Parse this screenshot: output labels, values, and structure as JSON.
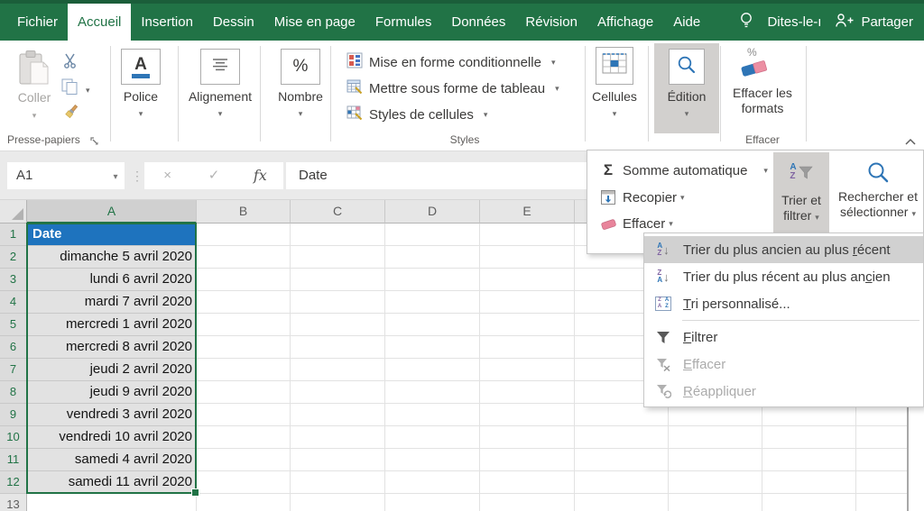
{
  "titlebar": {
    "tabs": [
      "Fichier",
      "Accueil",
      "Insertion",
      "Dessin",
      "Mise en page",
      "Formules",
      "Données",
      "Révision",
      "Affichage",
      "Aide"
    ],
    "active_tab": "Accueil",
    "tell_me": "Dites-le-ı",
    "share": "Partager"
  },
  "ribbon": {
    "clipboard": {
      "paste": "Coller",
      "group": "Presse-papiers"
    },
    "font": {
      "glyph": "A",
      "label": "Police"
    },
    "alignment": {
      "label": "Alignement"
    },
    "number": {
      "glyph": "%",
      "label": "Nombre"
    },
    "styles": {
      "conditional": "Mise en forme conditionnelle",
      "format_table": "Mettre sous forme de tableau",
      "cell_styles": "Styles de cellules",
      "group": "Styles"
    },
    "cells": {
      "label": "Cellules"
    },
    "editing": {
      "label": "Édition"
    },
    "clear": {
      "glyph": "%",
      "button_line1": "Effacer les",
      "button_line2": "formats",
      "group": "Effacer"
    }
  },
  "formula_bar": {
    "name_box": "A1",
    "cancel": "×",
    "enter": "✓",
    "function": "fx",
    "content": "Date"
  },
  "editing_flyout": {
    "sigma": "Σ",
    "autosum": "Somme automatique",
    "fill": "Recopier",
    "clear": "Effacer",
    "sort_filter": {
      "line1": "Trier et",
      "line2": "filtrer"
    },
    "find_select": {
      "line1": "Rechercher et",
      "line2": "sélectionner"
    }
  },
  "sort_menu": {
    "items": [
      {
        "pre": "Trier du plus ancien au plus ",
        "key": "r",
        "post": "écent",
        "state": "highlighted"
      },
      {
        "pre": "Trier du plus récent au plus an",
        "key": "c",
        "post": "ien",
        "state": "normal"
      },
      {
        "pre": "",
        "key": "T",
        "post": "ri personnalisé...",
        "state": "normal"
      },
      {
        "pre": "",
        "key": "F",
        "post": "iltrer",
        "state": "normal"
      },
      {
        "pre": "",
        "key": "E",
        "post": "ffacer",
        "state": "disabled"
      },
      {
        "pre": "",
        "key": "R",
        "post": "éappliquer",
        "state": "disabled"
      }
    ]
  },
  "sheet": {
    "col_headers": [
      "A",
      "B",
      "C",
      "D",
      "E"
    ],
    "active_cell": "A1",
    "rows": [
      {
        "n": "1",
        "a": "Date"
      },
      {
        "n": "2",
        "a": "dimanche 5 avril 2020"
      },
      {
        "n": "3",
        "a": "lundi 6 avril 2020"
      },
      {
        "n": "4",
        "a": "mardi 7 avril 2020"
      },
      {
        "n": "5",
        "a": "mercredi 1 avril 2020"
      },
      {
        "n": "6",
        "a": "mercredi 8 avril 2020"
      },
      {
        "n": "7",
        "a": "jeudi 2 avril 2020"
      },
      {
        "n": "8",
        "a": "jeudi 9 avril 2020"
      },
      {
        "n": "9",
        "a": "vendredi 3 avril 2020"
      },
      {
        "n": "10",
        "a": "vendredi 10 avril 2020"
      },
      {
        "n": "11",
        "a": "samedi 4 avril 2020"
      },
      {
        "n": "12",
        "a": "samedi 11 avril 2020"
      },
      {
        "n": "13",
        "a": ""
      }
    ]
  },
  "icons": {
    "letter_a": "A",
    "letter_z": "Z",
    "arrow_down": "↓"
  },
  "colors": {
    "excel_green": "#217346",
    "active_cell_fill": "#1E73BE",
    "pressed_grey": "#D2D0CE",
    "menu_highlight": "#D1D1D1"
  }
}
